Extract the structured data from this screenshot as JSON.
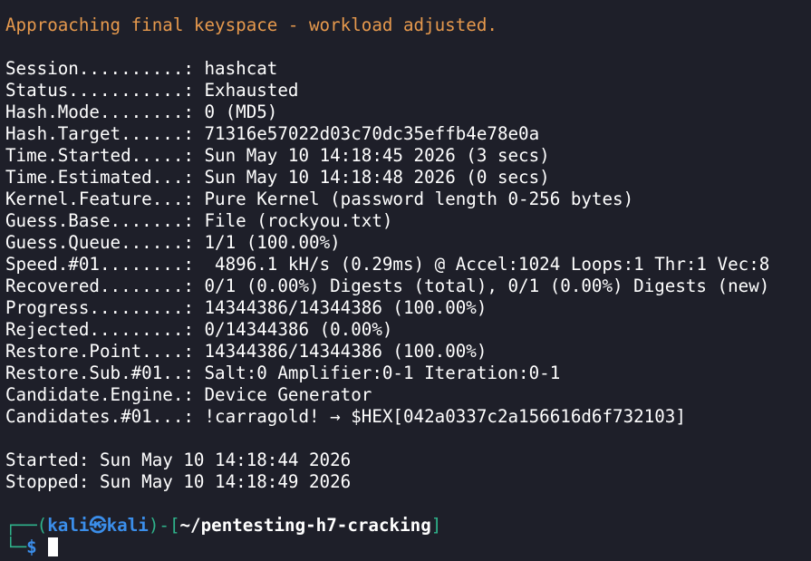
{
  "terminal": {
    "warning": "Approaching final keyspace - workload adjusted.",
    "status_lines": [
      {
        "key": "Session..........: ",
        "value": "hashcat"
      },
      {
        "key": "Status...........: ",
        "value": "Exhausted"
      },
      {
        "key": "Hash.Mode........: ",
        "value": "0 (MD5)"
      },
      {
        "key": "Hash.Target......: ",
        "value": "71316e57022d03c70dc35effb4e78e0a"
      },
      {
        "key": "Time.Started.....: ",
        "value": "Sun May 10 14:18:45 2026 (3 secs)"
      },
      {
        "key": "Time.Estimated...: ",
        "value": "Sun May 10 14:18:48 2026 (0 secs)"
      },
      {
        "key": "Kernel.Feature...: ",
        "value": "Pure Kernel (password length 0-256 bytes)"
      },
      {
        "key": "Guess.Base.......: ",
        "value": "File (rockyou.txt)"
      },
      {
        "key": "Guess.Queue......: ",
        "value": "1/1 (100.00%)"
      },
      {
        "key": "Speed.#01........: ",
        "value": " 4896.1 kH/s (0.29ms) @ Accel:1024 Loops:1 Thr:1 Vec:8"
      },
      {
        "key": "Recovered........: ",
        "value": "0/1 (0.00%) Digests (total), 0/1 (0.00%) Digests (new)"
      },
      {
        "key": "Progress.........: ",
        "value": "14344386/14344386 (100.00%)"
      },
      {
        "key": "Rejected.........: ",
        "value": "0/14344386 (0.00%)"
      },
      {
        "key": "Restore.Point....: ",
        "value": "14344386/14344386 (100.00%)"
      },
      {
        "key": "Restore.Sub.#01..: ",
        "value": "Salt:0 Amplifier:0-1 Iteration:0-1"
      },
      {
        "key": "Candidate.Engine.: ",
        "value": "Device Generator"
      },
      {
        "key": "Candidates.#01...: ",
        "value": "!carragold! → $HEX[042a0337c2a156616d6f732103]"
      }
    ],
    "started": "Started: Sun May 10 14:18:44 2026",
    "stopped": "Stopped: Sun May 10 14:18:49 2026",
    "prompt": {
      "frame_top": "┌──(",
      "user": "kali",
      "skull": "㉿",
      "host": "kali",
      "frame_mid": ")-[",
      "path": "~/pentesting-h7-cracking",
      "frame_end": "]",
      "frame_bottom": "└─",
      "dollar": "$"
    }
  }
}
